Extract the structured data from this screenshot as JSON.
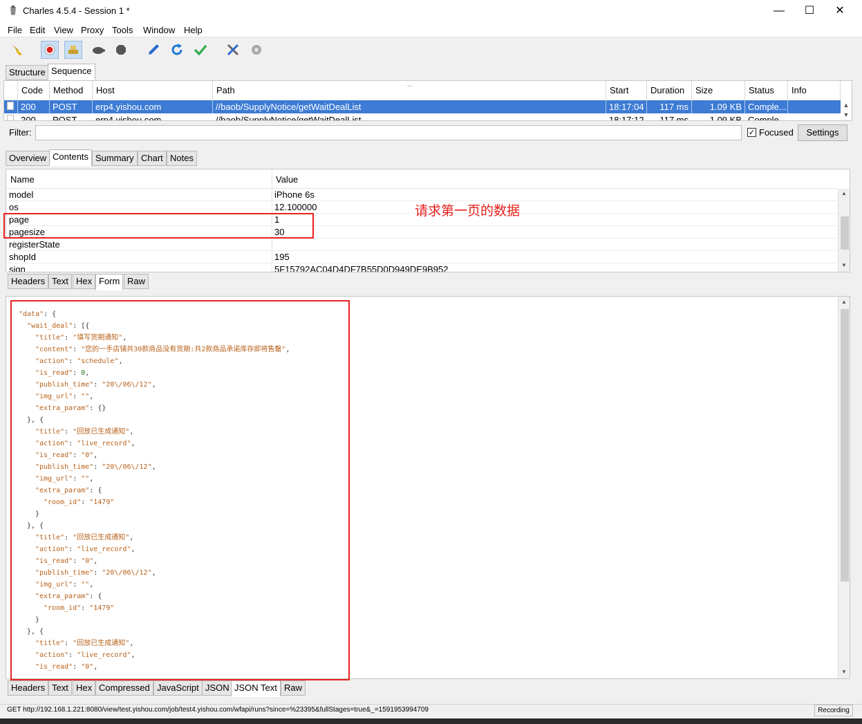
{
  "window": {
    "title": "Charles 4.5.4 - Session 1 *",
    "min": "—",
    "max": "☐",
    "close": "✕"
  },
  "menu": [
    "File",
    "Edit",
    "View",
    "Proxy",
    "Tools",
    "Window",
    "Help"
  ],
  "toolbar_icons": [
    "broom-icon",
    "record-icon",
    "throttle-icon",
    "turtle-icon",
    "stop-icon",
    "pen-icon",
    "refresh-icon",
    "check-icon",
    "tools-icon",
    "gear-icon"
  ],
  "view_tabs": {
    "structure": "Structure",
    "sequence": "Sequence"
  },
  "table": {
    "headers": {
      "code": "Code",
      "method": "Method",
      "host": "Host",
      "path": "Path",
      "start": "Start",
      "duration": "Duration",
      "size": "Size",
      "status": "Status",
      "info": "Info"
    },
    "rows": [
      {
        "code": "200",
        "method": "POST",
        "host": "erp4.yishou.com",
        "path": "//baob/SupplyNotice/getWaitDealList",
        "start": "18:17:04",
        "duration": "117 ms",
        "size": "1.09 KB",
        "status": "Comple..."
      },
      {
        "code": "200",
        "method": "POST",
        "host": "erp4.yishou.com",
        "path": "//baob/SupplyNotice/getWaitDealList",
        "start": "18:17:12",
        "duration": "117 ms",
        "size": "1.09 KB",
        "status": "Comple..."
      }
    ]
  },
  "filter": {
    "label": "Filter:",
    "value": "",
    "focused": "Focused",
    "settings": "Settings"
  },
  "detail_tabs": {
    "overview": "Overview",
    "contents": "Contents",
    "summary": "Summary",
    "chart": "Chart",
    "notes": "Notes"
  },
  "form": {
    "name_header": "Name",
    "value_header": "Value",
    "rows": [
      {
        "name": "model",
        "value": "iPhone 6s"
      },
      {
        "name": "os",
        "value": "12.100000"
      },
      {
        "name": "page",
        "value": "1"
      },
      {
        "name": "pagesize",
        "value": "30"
      },
      {
        "name": "registerState",
        "value": ""
      },
      {
        "name": "shopId",
        "value": "195"
      },
      {
        "name": "sign",
        "value": "5F15792AC04D4DF7B55D0D949DE9B952"
      }
    ]
  },
  "annotation": "请求第一页的数据",
  "request_tabs": {
    "headers": "Headers",
    "text": "Text",
    "hex": "Hex",
    "form": "Form",
    "raw": "Raw"
  },
  "response_tabs": {
    "headers": "Headers",
    "text": "Text",
    "hex": "Hex",
    "compressed": "Compressed",
    "javascript": "JavaScript",
    "json": "JSON",
    "json_text": "JSON Text",
    "raw": "Raw"
  },
  "json": {
    "data_key": "\"data\"",
    "wait_deal_key": "\"wait_deal\"",
    "items": [
      {
        "title": "\"填写货期通知\"",
        "content": "\"您的一手店铺共30款商品没有货期:共2款商品承诺库存即将售罄\"",
        "action": "\"schedule\"",
        "is_read": "0",
        "publish_time": "\"20\\/06\\/12\"",
        "img_url": "\"\"",
        "extra_param": "{}"
      },
      {
        "title": "\"回放已生成通知\"",
        "action": "\"live_record\"",
        "is_read": "\"0\"",
        "publish_time": "\"20\\/06\\/12\"",
        "img_url": "\"\"",
        "room_id": "\"1479\""
      },
      {
        "title": "\"回放已生成通知\"",
        "action": "\"live_record\"",
        "is_read": "\"0\"",
        "publish_time": "\"20\\/06\\/12\"",
        "img_url": "\"\"",
        "room_id": "\"1479\""
      },
      {
        "title": "\"回放已生成通知\"",
        "action": "\"live_record\"",
        "is_read": "\"0\""
      }
    ]
  },
  "status": {
    "text": "GET http://192.168.1.221:8080/view/test.yishou.com/job/test4.yishou.com/wfapi/runs?since=%23395&fullStages=true&_=1591953994709",
    "recording": "Recording"
  },
  "colors": {
    "selection": "#3d7bd4",
    "annotation_red": "#e8201c",
    "json_key": "#b8621a",
    "json_number": "#247a2a"
  }
}
